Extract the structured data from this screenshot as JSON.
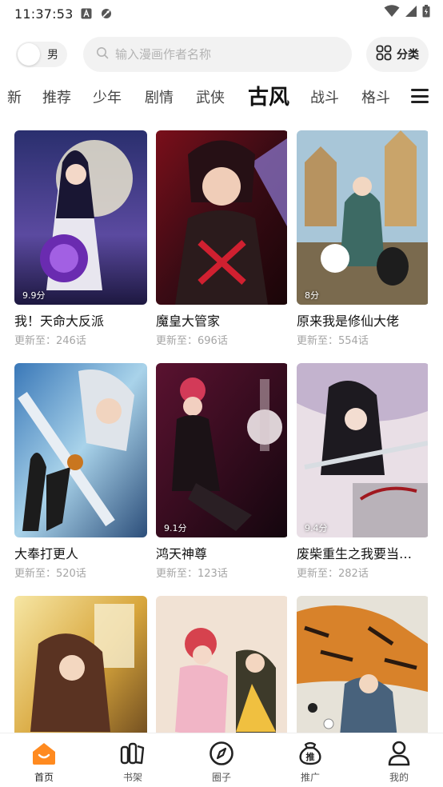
{
  "status_bar": {
    "time": "11:37:53"
  },
  "header": {
    "gender_label": "男",
    "search_placeholder": "输入漫画作者名称",
    "category_label": "分类"
  },
  "tabs": [
    {
      "label": "新",
      "active": false
    },
    {
      "label": "推荐",
      "active": false
    },
    {
      "label": "少年",
      "active": false
    },
    {
      "label": "剧情",
      "active": false
    },
    {
      "label": "武侠",
      "active": false
    },
    {
      "label": "古风",
      "active": true
    },
    {
      "label": "战斗",
      "active": false
    },
    {
      "label": "格斗",
      "active": false
    }
  ],
  "comics": [
    {
      "title": "我！天命大反派",
      "update": "更新至：246话",
      "score": "9.9分"
    },
    {
      "title": "魔皇大管家",
      "update": "更新至：696话",
      "score": ""
    },
    {
      "title": "原来我是修仙大佬",
      "update": "更新至：554话",
      "score": "8分"
    },
    {
      "title": "大奉打更人",
      "update": "更新至：520话",
      "score": ""
    },
    {
      "title": "鸿天神尊",
      "update": "更新至：123话",
      "score": "9.1分"
    },
    {
      "title": "废柴重生之我要当…",
      "update": "更新至：282话",
      "score": "9.4分"
    },
    {
      "title": "",
      "update": "",
      "score": ""
    },
    {
      "title": "",
      "update": "",
      "score": ""
    },
    {
      "title": "",
      "update": "",
      "score": ""
    }
  ],
  "bottom_nav": [
    {
      "label": "首页",
      "icon": "home-icon",
      "active": true
    },
    {
      "label": "书架",
      "icon": "bookshelf-icon",
      "active": false
    },
    {
      "label": "圈子",
      "icon": "compass-icon",
      "active": false
    },
    {
      "label": "推广",
      "icon": "promote-icon",
      "active": false
    },
    {
      "label": "我的",
      "icon": "profile-icon",
      "active": false
    }
  ],
  "colors": {
    "accent": "#ff8a1f",
    "text": "#222222",
    "muted": "#a5a5a5",
    "chip_bg": "#f2f2f2"
  }
}
